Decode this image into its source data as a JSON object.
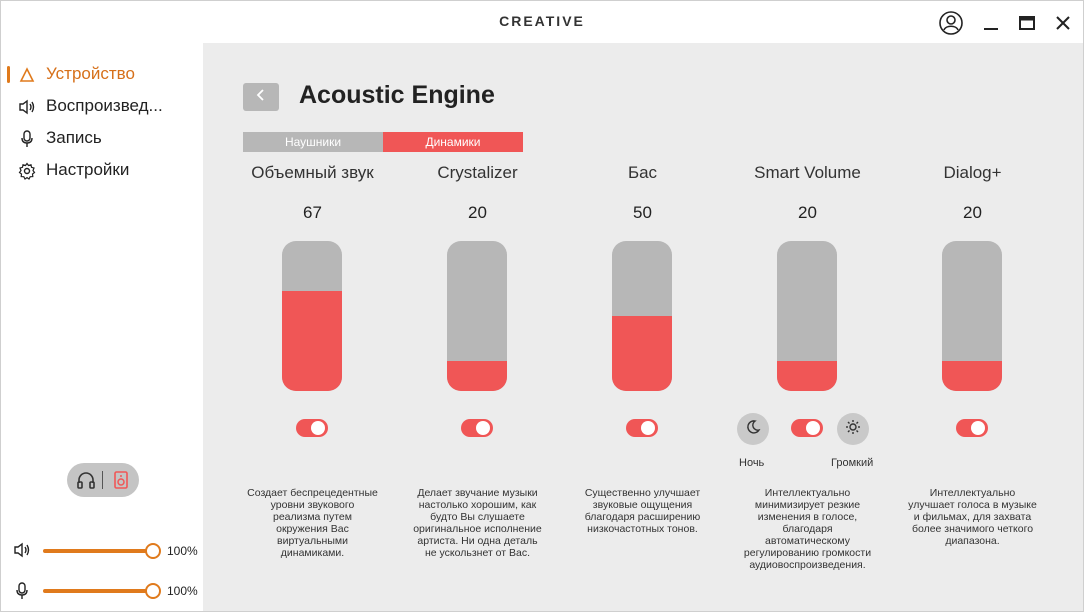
{
  "app": {
    "brand": "CREATIVE"
  },
  "titlebar": {
    "icons": [
      "user-icon",
      "minimize-icon",
      "maximize-icon",
      "close-icon"
    ]
  },
  "sidebar": {
    "items": [
      {
        "label": "Устройство",
        "icon": "device-icon",
        "active": true
      },
      {
        "label": "Воспроизвед...",
        "icon": "speaker-icon",
        "active": false
      },
      {
        "label": "Запись",
        "icon": "microphone-icon",
        "active": false
      },
      {
        "label": "Настройки",
        "icon": "gear-icon",
        "active": false
      }
    ],
    "output_switch": {
      "left_icon": "headphones-icon",
      "right_icon": "speaker-box-icon"
    },
    "playback_volume": {
      "label": "100%",
      "value": 100,
      "icon": "speaker-icon"
    },
    "mic_volume": {
      "label": "100%",
      "value": 100,
      "icon": "microphone-icon"
    }
  },
  "main": {
    "title": "Acoustic Engine",
    "back_icon": "chevron-left-icon",
    "tabs": [
      {
        "label": "Наушники",
        "selected": false
      },
      {
        "label": "Динамики",
        "selected": true
      }
    ],
    "effects": [
      {
        "name": "Объемный звук",
        "value": "67",
        "level": 67,
        "enabled": true,
        "description": "Создает беспрецедентные уровни звукового реализма путем окружения Вас виртуальными динамиками."
      },
      {
        "name": "Crystalizer",
        "value": "20",
        "level": 20,
        "enabled": true,
        "description": "Делает звучание музыки настолько хорошим, как будто Вы слушаете оригинальное исполнение артиста. Ни одна деталь не ускользнет от Вас."
      },
      {
        "name": "Бас",
        "value": "50",
        "level": 50,
        "enabled": true,
        "description": "Существенно улучшает звуковые ощущения благодаря расширению низкочастотных тонов."
      },
      {
        "name": "Smart Volume",
        "value": "20",
        "level": 20,
        "enabled": true,
        "description": "Интеллектуально минимизирует резкие изменения в голосе, благодаря автоматическому регулированию громкости аудиовоспроизведения.",
        "modes": {
          "night_label": "Ночь",
          "night_icon": "moon-icon",
          "loud_label": "Громкий",
          "loud_icon": "sun-icon"
        }
      },
      {
        "name": "Dialog+",
        "value": "20",
        "level": 20,
        "enabled": true,
        "description": "Интеллектуально улучшает голоса в музыке и фильмах, для захвата более значимого четкого диапазона."
      }
    ]
  },
  "colors": {
    "accent_orange": "#e07a1c",
    "accent_red": "#f05656",
    "track_gray": "#b7b7b7",
    "panel_bg": "#ececec"
  }
}
